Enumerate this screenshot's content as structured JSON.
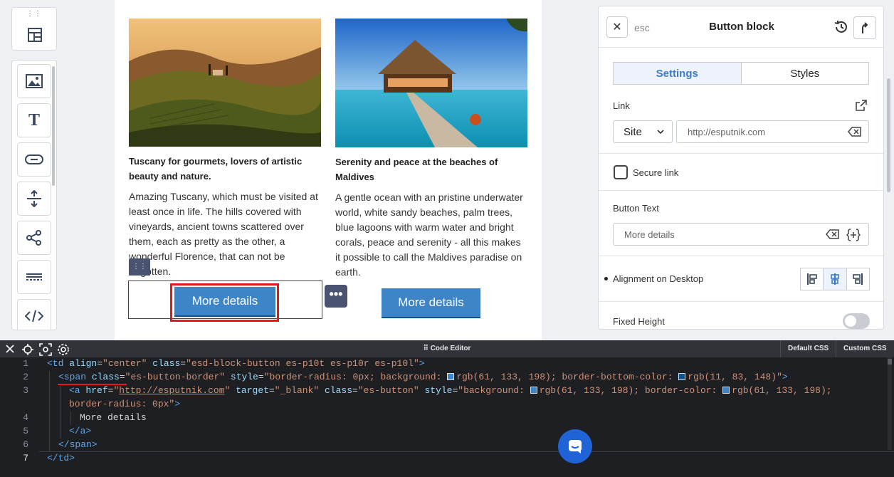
{
  "toolbar": {
    "grip": "⋮⋮",
    "items": [
      "image-block",
      "text-block",
      "button-block",
      "spacer-block",
      "social-block",
      "divider-block",
      "html-block"
    ]
  },
  "canvas": {
    "card1": {
      "title": "Tuscany for gourmets, lovers of artistic beauty and nature.",
      "text": "Amazing Tuscany, which must be visited at least once in life. The hills covered with vineyards, ancient towns scattered over them, each as pretty as the other, a wonderful Florence, that can not be forgotten.",
      "button": "More details"
    },
    "card2": {
      "title": "Serenity and peace at the beaches of Maldives",
      "text": "A gentle ocean with an pristine underwater world, white sandy beaches, palm trees, blue lagoons with warm water and bright corals, peace and serenity - all this makes it possible to call the Maldives paradise on earth.",
      "button": "More details"
    },
    "grip_label": "⋮⋮",
    "more_label": "•••"
  },
  "panel": {
    "close": "✕",
    "esc": "esc",
    "title": "Button block",
    "tabs": [
      "Settings",
      "Styles"
    ],
    "link_label": "Link",
    "link_type": "Site",
    "link_placeholder": "http://esputnik.com",
    "secure_link": "Secure link",
    "button_text_label": "Button Text",
    "button_text_value": "More details",
    "alignment_label": "Alignment on Desktop",
    "fixed_height_label": "Fixed Height",
    "fixed_height_on": false
  },
  "editor": {
    "title": "⠿ Code Editor",
    "tabs": [
      "Default CSS",
      "Custom CSS"
    ],
    "lines": [
      "1",
      "2",
      "3",
      "",
      "4",
      "5",
      "6",
      "7"
    ],
    "code": {
      "l1": {
        "tag": "<td",
        "a1": "align",
        "v1": "\"center\"",
        "a2": "class",
        "v2": "\"esd-block-button es-p10t es-p10r es-p10l\"",
        "end": ">"
      },
      "l2": {
        "tag": "<span",
        "a1": "class",
        "v1": "\"es-button-border\"",
        "a2": "style",
        "v2a": "\"border-radius: 0px; background: ",
        "c1": "rgb(61, 133, 198)",
        "v2b": "; border-bottom-color: ",
        "c2": "rgb(11, 83, 148)",
        "v2c": "\"",
        "end": ">"
      },
      "l3": {
        "tag": "<a",
        "a1": "href",
        "url": "http://esputnik.com",
        "a2": "target",
        "v2": "\"_blank\"",
        "a3": "class",
        "v3": "\"es-button\"",
        "a4": "style",
        "v4a": "\"background: ",
        "c1": "rgb(61, 133, 198)",
        "v4b": "; border-color: ",
        "c2": "rgb(61, 133, 198)",
        "v4c": ";"
      },
      "l3b": {
        "v": "border-radius: 0px\"",
        "end": ">"
      },
      "l4": "More details",
      "l5": "</a>",
      "l6": "</span>",
      "l7": "</td>"
    }
  },
  "colors": {
    "button_bg": "#3d85c6",
    "button_border": "#0b5394",
    "highlight": "#e8151b",
    "accent": "#3d7cc9"
  }
}
